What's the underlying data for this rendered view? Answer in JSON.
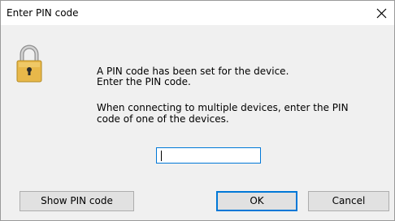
{
  "window": {
    "title": "Enter PIN code",
    "close_icon": "close-icon"
  },
  "icon": {
    "name": "padlock-icon",
    "body_color": "#e8b84a",
    "shackle_color": "#b8b8b8"
  },
  "message": {
    "line1": "A PIN code has been set for the device.",
    "line2": "Enter the PIN code.",
    "line3": "When connecting to multiple devices, enter the PIN",
    "line4": "code of one of the devices."
  },
  "pin_input": {
    "value": ""
  },
  "buttons": {
    "show_pin": "Show PIN code",
    "ok": "OK",
    "cancel": "Cancel"
  },
  "colors": {
    "focus_border": "#0078d7",
    "dialog_bg": "#f0f0f0",
    "button_bg": "#e1e1e1"
  }
}
